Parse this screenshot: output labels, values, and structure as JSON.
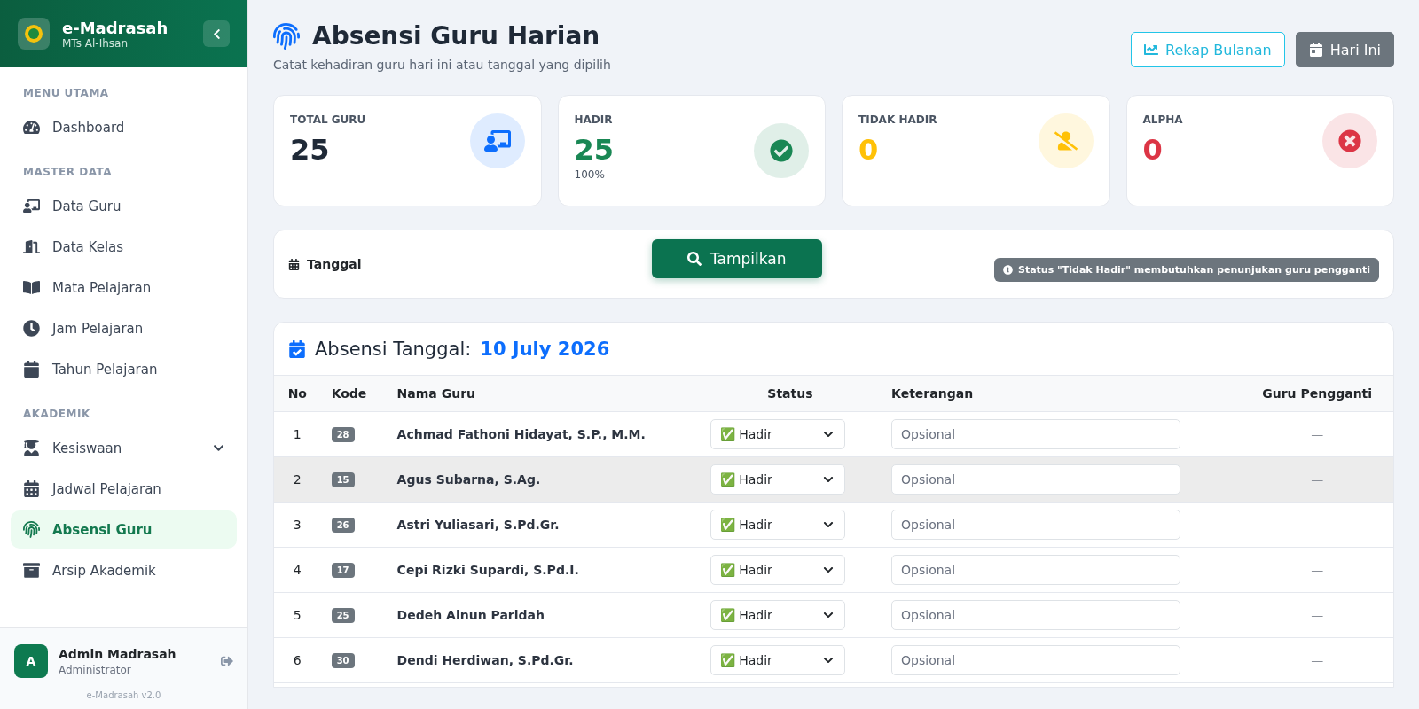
{
  "sidebar": {
    "brand": {
      "name": "e-Madrasah",
      "school": "MTs Al-Ihsan"
    },
    "sections": [
      {
        "title": "MENU UTAMA",
        "items": [
          {
            "label": "Dashboard",
            "selected": false
          }
        ]
      },
      {
        "title": "MASTER DATA",
        "items": [
          {
            "label": "Data Guru",
            "selected": false
          },
          {
            "label": "Data Kelas",
            "selected": false
          },
          {
            "label": "Mata Pelajaran",
            "selected": false
          },
          {
            "label": "Jam Pelajaran",
            "selected": false
          },
          {
            "label": "Tahun Pelajaran",
            "selected": false
          }
        ]
      },
      {
        "title": "AKADEMIK",
        "items": [
          {
            "label": "Kesiswaan",
            "selected": false,
            "expandable": true
          },
          {
            "label": "Jadwal Pelajaran",
            "selected": false
          },
          {
            "label": "Absensi Guru",
            "selected": true
          },
          {
            "label": "Arsip Akademik",
            "selected": false
          }
        ]
      }
    ],
    "user": {
      "initial": "A",
      "name": "Admin Madrasah",
      "role": "Administrator"
    },
    "version": "e-Madrasah v2.0"
  },
  "header": {
    "title": "Absensi Guru Harian",
    "subtitle": "Catat kehadiran guru hari ini atau tanggal yang dipilih",
    "buttons": [
      {
        "label": "Rekap Bulanan",
        "kind": "outline"
      },
      {
        "label": "Hari Ini",
        "kind": "solid"
      }
    ]
  },
  "stats": [
    {
      "label": "TOTAL GURU",
      "value": "25",
      "kind": "total",
      "color": "#1f2937"
    },
    {
      "label": "HADIR",
      "value": "25",
      "note": "100%",
      "kind": "present",
      "color": "#198754"
    },
    {
      "label": "TIDAK HADIR",
      "value": "0",
      "kind": "absent",
      "color": "#ffc107"
    },
    {
      "label": "ALPHA",
      "value": "0",
      "kind": "alpha",
      "color": "#dc3545"
    }
  ],
  "filter": {
    "label": "Tanggal",
    "button": "Tampilkan",
    "notice": "Status \"Tidak Hadir\" membutuhkan penunjukan guru pengganti"
  },
  "table": {
    "title": "Absensi Tanggal:",
    "date": "10 July 2026",
    "columns": [
      "No",
      "Kode",
      "Nama Guru",
      "Status",
      "Keterangan",
      "Guru Pengganti"
    ],
    "rows": [
      {
        "no": "1",
        "code": "28",
        "name": "Achmad Fathoni Hidayat, S.P., M.M.",
        "status": "✅ Hadir",
        "note_placeholder": "Opsional",
        "substitute": "—",
        "highlighted": false
      },
      {
        "no": "2",
        "code": "15",
        "name": "Agus Subarna, S.Ag.",
        "status": "✅ Hadir",
        "note_placeholder": "Opsional",
        "substitute": "—",
        "highlighted": true
      },
      {
        "no": "3",
        "code": "26",
        "name": "Astri Yuliasari, S.Pd.Gr.",
        "status": "✅ Hadir",
        "note_placeholder": "Opsional",
        "substitute": "—",
        "highlighted": false
      },
      {
        "no": "4",
        "code": "17",
        "name": "Cepi Rizki Supardi, S.Pd.I.",
        "status": "✅ Hadir",
        "note_placeholder": "Opsional",
        "substitute": "—",
        "highlighted": false
      },
      {
        "no": "5",
        "code": "25",
        "name": "Dedeh Ainun Paridah",
        "status": "✅ Hadir",
        "note_placeholder": "Opsional",
        "substitute": "—",
        "highlighted": false
      },
      {
        "no": "6",
        "code": "30",
        "name": "Dendi Herdiwan, S.Pd.Gr.",
        "status": "✅ Hadir",
        "note_placeholder": "Opsional",
        "substitute": "—",
        "highlighted": false
      }
    ]
  }
}
